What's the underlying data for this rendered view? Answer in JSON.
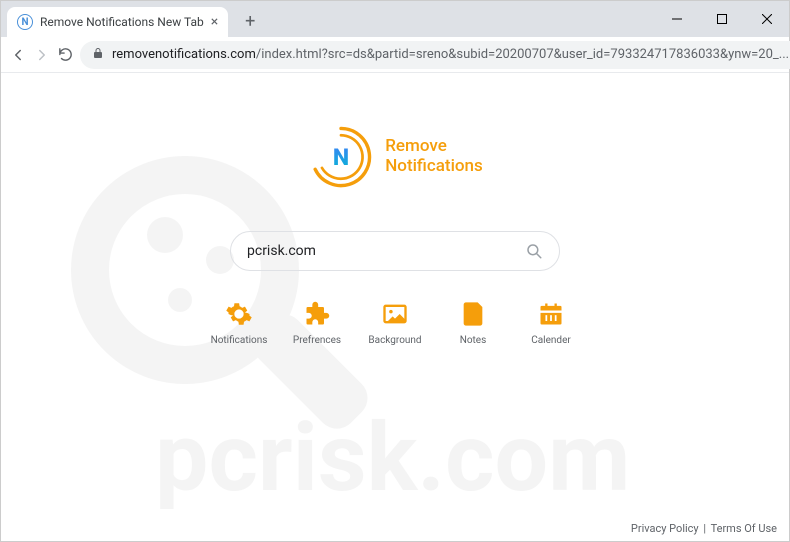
{
  "window": {
    "tab_title": "Remove Notifications New Tab"
  },
  "toolbar": {
    "url_domain": "removenotifications.com",
    "url_path": "/index.html?src=ds&partid=sreno&subid=20200707&user_id=793324717836033&ynw=20_..."
  },
  "logo": {
    "line1": "Remove",
    "line2": "Notifications"
  },
  "search": {
    "value": "pcrisk.com",
    "placeholder": ""
  },
  "shortcuts": [
    {
      "id": "notifications",
      "label": "Notifications"
    },
    {
      "id": "prefrences",
      "label": "Prefrences"
    },
    {
      "id": "background",
      "label": "Background"
    },
    {
      "id": "notes",
      "label": "Notes"
    },
    {
      "id": "calender",
      "label": "Calender"
    }
  ],
  "footer": {
    "privacy": "Privacy Policy",
    "terms": "Terms Of Use"
  },
  "watermark": {
    "text": "pcrisk.com"
  }
}
